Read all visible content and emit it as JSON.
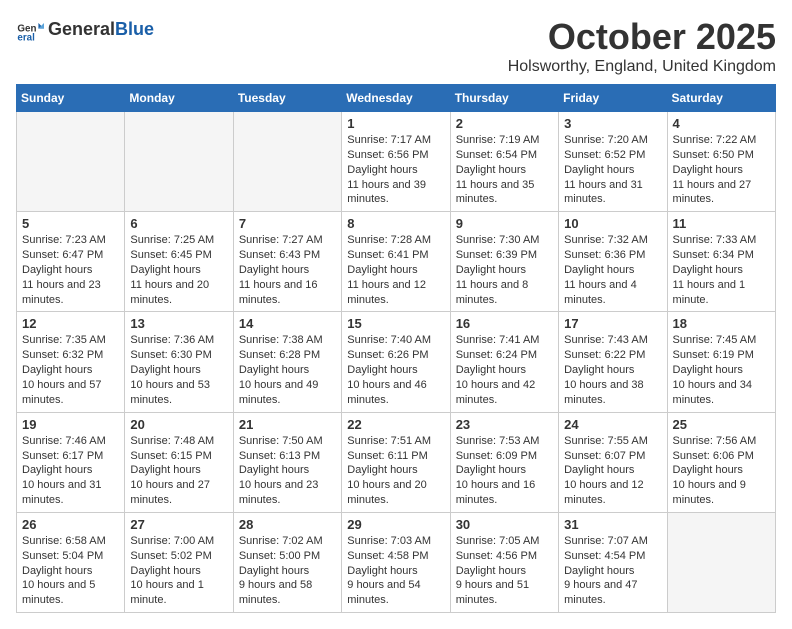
{
  "logo": {
    "general": "General",
    "blue": "Blue"
  },
  "title": "October 2025",
  "location": "Holsworthy, England, United Kingdom",
  "weekdays": [
    "Sunday",
    "Monday",
    "Tuesday",
    "Wednesday",
    "Thursday",
    "Friday",
    "Saturday"
  ],
  "weeks": [
    [
      {
        "day": "",
        "empty": true
      },
      {
        "day": "",
        "empty": true
      },
      {
        "day": "",
        "empty": true
      },
      {
        "day": "1",
        "sunrise": "7:17 AM",
        "sunset": "6:56 PM",
        "daylight": "11 hours and 39 minutes."
      },
      {
        "day": "2",
        "sunrise": "7:19 AM",
        "sunset": "6:54 PM",
        "daylight": "11 hours and 35 minutes."
      },
      {
        "day": "3",
        "sunrise": "7:20 AM",
        "sunset": "6:52 PM",
        "daylight": "11 hours and 31 minutes."
      },
      {
        "day": "4",
        "sunrise": "7:22 AM",
        "sunset": "6:50 PM",
        "daylight": "11 hours and 27 minutes."
      }
    ],
    [
      {
        "day": "5",
        "sunrise": "7:23 AM",
        "sunset": "6:47 PM",
        "daylight": "11 hours and 23 minutes."
      },
      {
        "day": "6",
        "sunrise": "7:25 AM",
        "sunset": "6:45 PM",
        "daylight": "11 hours and 20 minutes."
      },
      {
        "day": "7",
        "sunrise": "7:27 AM",
        "sunset": "6:43 PM",
        "daylight": "11 hours and 16 minutes."
      },
      {
        "day": "8",
        "sunrise": "7:28 AM",
        "sunset": "6:41 PM",
        "daylight": "11 hours and 12 minutes."
      },
      {
        "day": "9",
        "sunrise": "7:30 AM",
        "sunset": "6:39 PM",
        "daylight": "11 hours and 8 minutes."
      },
      {
        "day": "10",
        "sunrise": "7:32 AM",
        "sunset": "6:36 PM",
        "daylight": "11 hours and 4 minutes."
      },
      {
        "day": "11",
        "sunrise": "7:33 AM",
        "sunset": "6:34 PM",
        "daylight": "11 hours and 1 minute."
      }
    ],
    [
      {
        "day": "12",
        "sunrise": "7:35 AM",
        "sunset": "6:32 PM",
        "daylight": "10 hours and 57 minutes."
      },
      {
        "day": "13",
        "sunrise": "7:36 AM",
        "sunset": "6:30 PM",
        "daylight": "10 hours and 53 minutes."
      },
      {
        "day": "14",
        "sunrise": "7:38 AM",
        "sunset": "6:28 PM",
        "daylight": "10 hours and 49 minutes."
      },
      {
        "day": "15",
        "sunrise": "7:40 AM",
        "sunset": "6:26 PM",
        "daylight": "10 hours and 46 minutes."
      },
      {
        "day": "16",
        "sunrise": "7:41 AM",
        "sunset": "6:24 PM",
        "daylight": "10 hours and 42 minutes."
      },
      {
        "day": "17",
        "sunrise": "7:43 AM",
        "sunset": "6:22 PM",
        "daylight": "10 hours and 38 minutes."
      },
      {
        "day": "18",
        "sunrise": "7:45 AM",
        "sunset": "6:19 PM",
        "daylight": "10 hours and 34 minutes."
      }
    ],
    [
      {
        "day": "19",
        "sunrise": "7:46 AM",
        "sunset": "6:17 PM",
        "daylight": "10 hours and 31 minutes."
      },
      {
        "day": "20",
        "sunrise": "7:48 AM",
        "sunset": "6:15 PM",
        "daylight": "10 hours and 27 minutes."
      },
      {
        "day": "21",
        "sunrise": "7:50 AM",
        "sunset": "6:13 PM",
        "daylight": "10 hours and 23 minutes."
      },
      {
        "day": "22",
        "sunrise": "7:51 AM",
        "sunset": "6:11 PM",
        "daylight": "10 hours and 20 minutes."
      },
      {
        "day": "23",
        "sunrise": "7:53 AM",
        "sunset": "6:09 PM",
        "daylight": "10 hours and 16 minutes."
      },
      {
        "day": "24",
        "sunrise": "7:55 AM",
        "sunset": "6:07 PM",
        "daylight": "10 hours and 12 minutes."
      },
      {
        "day": "25",
        "sunrise": "7:56 AM",
        "sunset": "6:06 PM",
        "daylight": "10 hours and 9 minutes."
      }
    ],
    [
      {
        "day": "26",
        "sunrise": "6:58 AM",
        "sunset": "5:04 PM",
        "daylight": "10 hours and 5 minutes."
      },
      {
        "day": "27",
        "sunrise": "7:00 AM",
        "sunset": "5:02 PM",
        "daylight": "10 hours and 1 minute."
      },
      {
        "day": "28",
        "sunrise": "7:02 AM",
        "sunset": "5:00 PM",
        "daylight": "9 hours and 58 minutes."
      },
      {
        "day": "29",
        "sunrise": "7:03 AM",
        "sunset": "4:58 PM",
        "daylight": "9 hours and 54 minutes."
      },
      {
        "day": "30",
        "sunrise": "7:05 AM",
        "sunset": "4:56 PM",
        "daylight": "9 hours and 51 minutes."
      },
      {
        "day": "31",
        "sunrise": "7:07 AM",
        "sunset": "4:54 PM",
        "daylight": "9 hours and 47 minutes."
      },
      {
        "day": "",
        "empty": true
      }
    ]
  ]
}
